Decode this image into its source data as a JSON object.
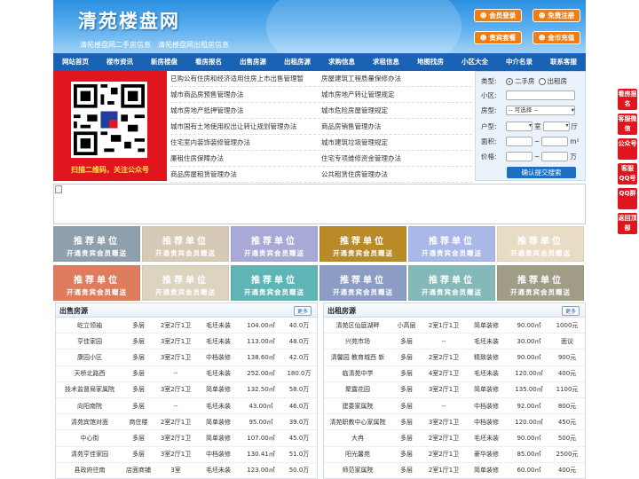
{
  "header": {
    "logo": "清苑楼盘网",
    "subtitle": "清苑楼盘网二手房信息　清苑楼盘网出租房信息",
    "buttons": [
      "会员登录",
      "免费注册",
      "贵宾套餐",
      "金币充值"
    ]
  },
  "nav": [
    "网站首页",
    "楼市资讯",
    "新房楼盘",
    "看房报名",
    "出售房源",
    "出租房源",
    "求购信息",
    "求租信息",
    "地图找房",
    "小区大全",
    "中介名录",
    "联系客服"
  ],
  "qr": {
    "caption": "扫描二维码，关注公众号"
  },
  "links": [
    [
      "已购公有住房和经济适用住房上市出售管理暂",
      "房屋建筑工程质量保修办法"
    ],
    [
      "城市商品房预售管理办法",
      "城市房地产转让管理规定"
    ],
    [
      "城市房地产抵押管理办法",
      "城市危险房屋管理规定"
    ],
    [
      "城市国有土地使用权出让转让规划管理办法",
      "商品房销售管理办法"
    ],
    [
      "住宅室内装饰装修管理办法",
      "城市建筑垃圾管理规定"
    ],
    [
      "廉租住房保障办法",
      "住宅专项维修资金管理办法"
    ],
    [
      "商品房屋租赁管理办法",
      "公共租赁住房管理办法"
    ]
  ],
  "search": {
    "type_label": "类型:",
    "opt1": "二手房",
    "opt2": "出租房",
    "area_label": "小区:",
    "housetype_label": "房型:",
    "select_value": "-- 可选择 --",
    "layout_label": "户型:",
    "room": "室",
    "hall": "厅",
    "size_label": "面积:",
    "unit_size": "m²",
    "price_label": "价格:",
    "unit_price": "万",
    "submit": "确认提交搜索"
  },
  "ad": {
    "line1": "推荐单位",
    "line2": "开通贵宾会员赠送"
  },
  "ad_colors": [
    "#8fa0ad",
    "#d6c9b6",
    "#a9a9d8",
    "#b88a28",
    "#a9b8e6",
    "#e8dcc5",
    "#df7c5d",
    "#dcd3c0",
    "#5fb5b5",
    "#8c9cc4",
    "#85b8b8",
    "#a09c86"
  ],
  "sale": {
    "title": "出售房源",
    "more": "更多",
    "rows": [
      [
        "屹立领袖",
        "多层",
        "2室2厅1卫",
        "毛坯未装",
        "104.00㎡",
        "40.0万"
      ],
      [
        "亨佳家园",
        "多层",
        "3室2厅1卫",
        "毛坯未装",
        "113.00㎡",
        "48.0万"
      ],
      [
        "康园小区",
        "多层",
        "3室2厅1卫",
        "中档装修",
        "138.60㎡",
        "42.0万"
      ],
      [
        "天桥北路西",
        "多层",
        "--",
        "毛坯未装",
        "252.00㎡",
        "180.0万"
      ],
      [
        "技术监督局家属院",
        "多层",
        "3室2厅1卫",
        "简单装修",
        "132.50㎡",
        "58.0万"
      ],
      [
        "向阳南院",
        "多层",
        "--",
        "毛坯未装",
        "43.00㎡",
        "46.0万"
      ],
      [
        "清苑宾馆对面",
        "商住楼",
        "2室2厅1卫",
        "简单装修",
        "95.00㎡",
        "39.0万"
      ],
      [
        "中心街",
        "多层",
        "3室2厅1卫",
        "简单装修",
        "107.00㎡",
        "45.0万"
      ],
      [
        "清苑亨佳家园",
        "多层",
        "3室2厅1卫",
        "中档装修",
        "130.41㎡",
        "51.0万"
      ],
      [
        "县政府往南",
        "店面商铺",
        "3室",
        "毛坯未装",
        "123.00㎡",
        "50.0万"
      ]
    ]
  },
  "rent": {
    "title": "出租房源",
    "more": "更多",
    "rows": [
      [
        "清苑区仙庭湖畔",
        "小高层",
        "2室1厅1卫",
        "简单装修",
        "90.00㎡",
        "1000元"
      ],
      [
        "兴苑市场",
        "多层",
        "--",
        "毛坯未装",
        "30.00㎡",
        "面议"
      ],
      [
        "清馨园 教育城西 新",
        "多层",
        "2室2厅1卫",
        "精致装修",
        "90.00㎡",
        "900元"
      ],
      [
        "临清苑中学",
        "多层",
        "4室2厅1卫",
        "毛坯未装",
        "120.00㎡",
        "400元"
      ],
      [
        "聚露花园",
        "多层",
        "3室2厅1卫",
        "简单装修",
        "135.00㎡",
        "1100元"
      ],
      [
        "建委家属院",
        "多层",
        "--",
        "中档装修",
        "92.00㎡",
        "800元"
      ],
      [
        "清苑职教中心家属院",
        "多层",
        "3室2厅1卫",
        "中档装修",
        "120.00㎡",
        "450元"
      ],
      [
        "大冉",
        "多层",
        "2室2厅1卫",
        "毛坯未装",
        "90.00㎡",
        "500元"
      ],
      [
        "阳光馨苑",
        "多层",
        "2室2厅1卫",
        "豪华装修",
        "85.00㎡",
        "2500元"
      ],
      [
        "师范家属院",
        "多层",
        "2室1厅1卫",
        "简单装修",
        "60.00㎡",
        "400元"
      ]
    ]
  },
  "float": [
    "看房报名",
    "客服微信",
    "公众号",
    "客服QQ号",
    "QQ群",
    "返回顶部"
  ]
}
